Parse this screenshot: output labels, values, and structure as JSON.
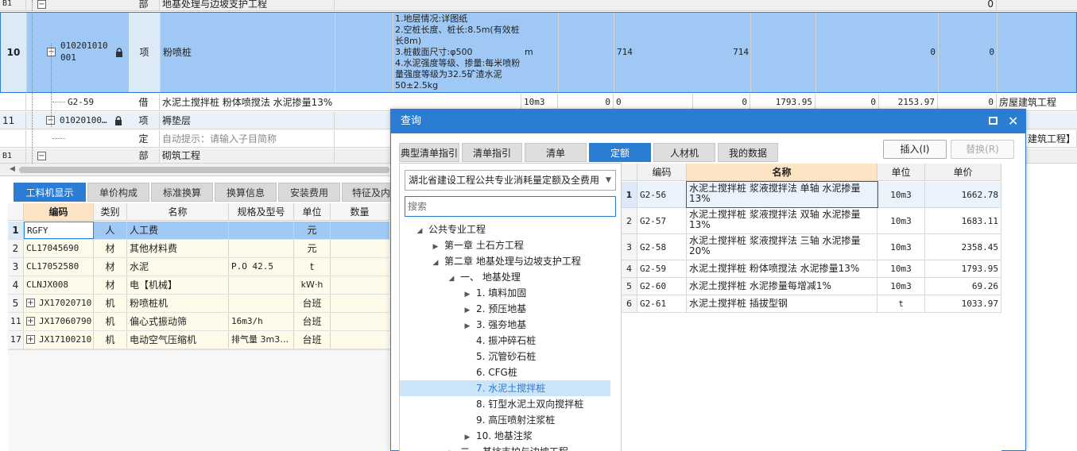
{
  "top_grid": {
    "rows": [
      {
        "no": "B1",
        "type": "部",
        "name": "地基处理与边坡支护工程",
        "last": "0"
      },
      {
        "no": "10",
        "code": "010201010001",
        "type": "项",
        "name": "粉喷桩",
        "features": [
          "1.地层情况:详图纸",
          "2.空桩长度、桩长:8.5m(有效桩长8m)",
          "3.桩截面尺寸:φ500",
          "4.水泥强度等级、掺量:每米喷粉量强度等级为32.5矿渣水泥50±2.5kg"
        ],
        "unit": "m",
        "qty1": "714",
        "qty2": "714",
        "v1": "0",
        "v2": "0"
      },
      {
        "code": "G2-59",
        "type": "借",
        "name": "水泥土搅拌桩 粉体喷搅法 水泥掺量13%",
        "unit": "10m3",
        "c1": "0",
        "c2": "0",
        "c3": "0",
        "price": "1793.95",
        "c4": "0",
        "total": "2153.97",
        "c5": "0",
        "prof": "房屋建筑工程"
      },
      {
        "no": "11",
        "code": "01020100…",
        "type": "项",
        "name": "褥垫层"
      },
      {
        "type": "定",
        "name": "自动提示：请输入子目简称",
        "prof": "建筑工程】"
      },
      {
        "no": "B1",
        "type": "部",
        "name": "砌筑工程"
      }
    ]
  },
  "bottom_tabs": [
    "工料机显示",
    "单价构成",
    "标准换算",
    "换算信息",
    "安装费用",
    "特征及内"
  ],
  "bottom_headers": [
    "编码",
    "类别",
    "名称",
    "规格及型号",
    "单位",
    "数量"
  ],
  "bottom_rows": [
    {
      "no": "1",
      "code": "RGFY",
      "cat": "人",
      "name": "人工费",
      "spec": "",
      "unit": "元"
    },
    {
      "no": "2",
      "code": "CL17045690",
      "cat": "材",
      "name": "其他材料费",
      "spec": "",
      "unit": "元"
    },
    {
      "no": "3",
      "code": "CL17052580",
      "cat": "材",
      "name": "水泥",
      "spec": "P.O 42.5",
      "unit": "t"
    },
    {
      "no": "4",
      "code": "CLNJX008",
      "cat": "材",
      "name": "电【机械】",
      "spec": "",
      "unit": "kW·h"
    },
    {
      "no": "5",
      "code": "JX17020710",
      "cat": "机",
      "name": "粉喷桩机",
      "spec": "",
      "unit": "台班"
    },
    {
      "no": "11",
      "code": "JX17060790",
      "cat": "机",
      "name": "偏心式振动筛",
      "spec": "16m3/h",
      "unit": "台班"
    },
    {
      "no": "17",
      "code": "JX17100210",
      "cat": "机",
      "name": "电动空气压缩机",
      "spec": "排气量 3m3…",
      "unit": "台班"
    }
  ],
  "dialog": {
    "title": "查询",
    "tabs": [
      "典型清单指引",
      "清单指引",
      "清单",
      "定额",
      "人材机",
      "我的数据"
    ],
    "insert_btn": "插入(I)",
    "replace_btn": "替换(R)",
    "quota_lib": "湖北省建设工程公共专业消耗量定额及全费用基",
    "search_placeholder": "搜索",
    "tree": [
      {
        "label": "公共专业工程",
        "arrow": "down",
        "level": 0
      },
      {
        "label": "第一章 土石方工程",
        "arrow": "right",
        "level": 1
      },
      {
        "label": "第二章 地基处理与边坡支护工程",
        "arrow": "down",
        "level": 1
      },
      {
        "label": "一、 地基处理",
        "arrow": "down",
        "level": 2
      },
      {
        "label": "1. 填料加固",
        "arrow": "right",
        "level": 3
      },
      {
        "label": "2. 预压地基",
        "arrow": "right",
        "level": 3
      },
      {
        "label": "3. 强夯地基",
        "arrow": "right",
        "level": 3
      },
      {
        "label": "4. 振冲碎石桩",
        "arrow": "",
        "level": 3
      },
      {
        "label": "5. 沉管砂石桩",
        "arrow": "",
        "level": 3
      },
      {
        "label": "6. CFG桩",
        "arrow": "",
        "level": 3
      },
      {
        "label": "7. 水泥土搅拌桩",
        "arrow": "",
        "level": 3,
        "selected": true
      },
      {
        "label": "8. 钉型水泥土双向搅拌桩",
        "arrow": "",
        "level": 3
      },
      {
        "label": "9. 高压喷射注浆桩",
        "arrow": "",
        "level": 3
      },
      {
        "label": "10. 地基注浆",
        "arrow": "right",
        "level": 3
      },
      {
        "label": "二、 基坑支护与边坡工程",
        "arrow": "right",
        "level": 2
      }
    ],
    "result_headers": [
      "编码",
      "名称",
      "单位",
      "单价"
    ],
    "results": [
      {
        "no": "1",
        "code": "G2-56",
        "name": "水泥土搅拌桩 浆液搅拌法 单轴 水泥掺量13%",
        "unit": "10m3",
        "price": "1662.78"
      },
      {
        "no": "2",
        "code": "G2-57",
        "name": "水泥土搅拌桩 浆液搅拌法 双轴 水泥掺量13%",
        "unit": "10m3",
        "price": "1683.11"
      },
      {
        "no": "3",
        "code": "G2-58",
        "name": "水泥土搅拌桩 浆液搅拌法 三轴 水泥掺量20%",
        "unit": "10m3",
        "price": "2358.45"
      },
      {
        "no": "4",
        "code": "G2-59",
        "name": "水泥土搅拌桩 粉体喷搅法 水泥掺量13%",
        "unit": "10m3",
        "price": "1793.95"
      },
      {
        "no": "5",
        "code": "G2-60",
        "name": "水泥土搅拌桩 水泥掺量每增减1%",
        "unit": "10m3",
        "price": "69.26"
      },
      {
        "no": "6",
        "code": "G2-61",
        "name": "水泥土搅拌桩 插拔型钢",
        "unit": "t",
        "price": "1033.97"
      }
    ]
  },
  "colors": {
    "accent": "#2b7cd3",
    "selected_row": "#9fc8f4",
    "tree_selected": "#cce4f7"
  }
}
